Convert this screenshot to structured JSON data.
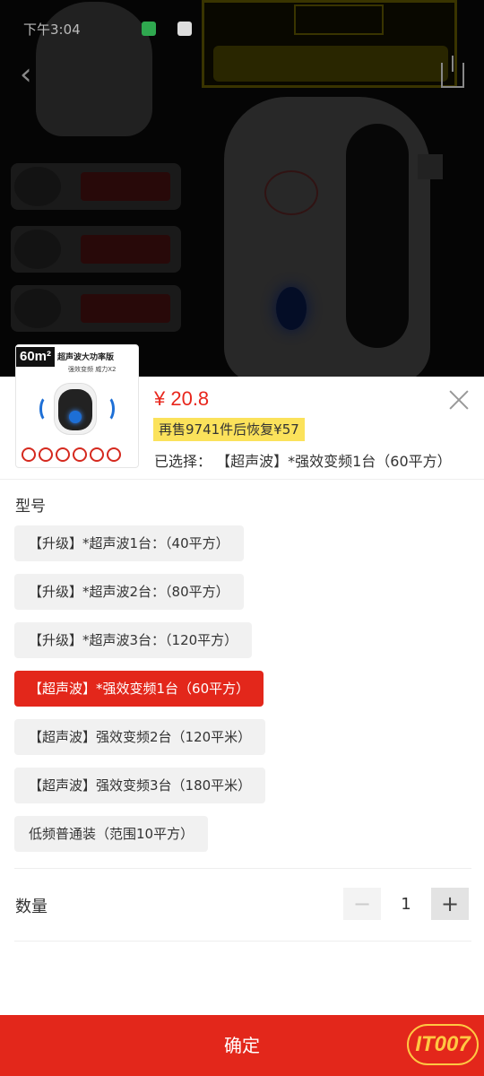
{
  "status_bar": {
    "time": "下午3:04"
  },
  "product": {
    "thumbnail": {
      "badge": "60m²",
      "caption": "超声波大功率版",
      "caption_sub": "强效变频 威力X2"
    },
    "price": "¥ 20.8",
    "promo": "再售9741件后恢复¥57",
    "selected_text": "已选择：   【超声波】*强效变频1台（60平方）"
  },
  "spec": {
    "title": "型号",
    "options": [
      "【升级】*超声波1台：（40平方）",
      "【升级】*超声波2台：（80平方）",
      "【升级】*超声波3台：（120平方）",
      "【超声波】*强效变频1台（60平方）",
      "【超声波】强效变频2台（120平米）",
      "【超声波】强效变频3台（180平米）",
      "低频普通装（范围10平方）"
    ],
    "selected_index": 3
  },
  "quantity": {
    "label": "数量",
    "value": "1",
    "minus": "−",
    "plus": "+"
  },
  "confirm_label": "确定",
  "watermark": "IT007",
  "colors": {
    "accent": "#e3271b",
    "promo_bg": "#fbe25b",
    "price": "#e8261c"
  }
}
